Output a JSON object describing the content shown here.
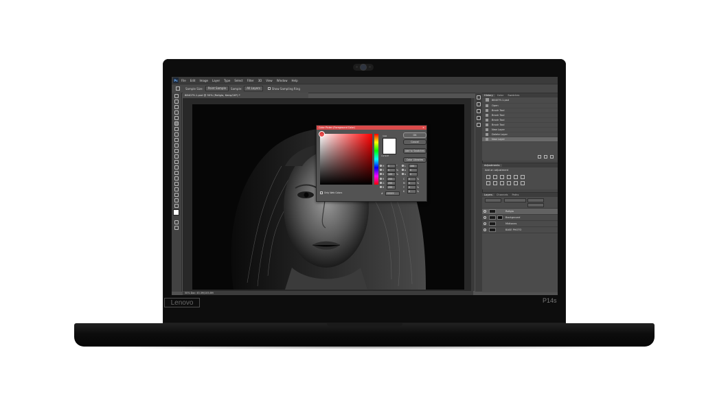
{
  "device": {
    "brand_left": "Lenovo",
    "model_right": "P14s"
  },
  "app": {
    "menu": [
      "File",
      "Edit",
      "Image",
      "Layer",
      "Type",
      "Select",
      "Filter",
      "3D",
      "View",
      "Window",
      "Help"
    ],
    "logo": "Ps",
    "options": {
      "sample_size_label": "Sample Size:",
      "sample_size_value": "Point Sample",
      "sample_label": "Sample:",
      "sample_value": "All Layers",
      "show_ring_label": "Show Sampling Ring"
    },
    "document_tab": "884079-1.psd @ 50% (Rollglo, Keep/16*) *",
    "status": "50%     Doc: 45.3M/105.8M"
  },
  "color_picker": {
    "title": "Color Picker (Foreground Color)",
    "ok": "OK",
    "cancel": "Cancel",
    "add_to_swatches": "Add to Swatches",
    "color_libraries": "Color Libraries",
    "new_label": "new",
    "current_label": "current",
    "only_web_colors": "Only Web Colors",
    "hex_label": "#",
    "hex_value": "FFFFFF",
    "fields": [
      {
        "label": "H",
        "value": "0",
        "unit": "°"
      },
      {
        "label": "S",
        "value": "0",
        "unit": "%"
      },
      {
        "label": "B",
        "value": "100",
        "unit": "%"
      },
      {
        "label": "R",
        "value": "255",
        "unit": ""
      },
      {
        "label": "G",
        "value": "255",
        "unit": ""
      },
      {
        "label": "B",
        "value": "255",
        "unit": ""
      }
    ],
    "lab_cmyk": [
      {
        "label": "L",
        "value": "100"
      },
      {
        "label": "a",
        "value": "0"
      },
      {
        "label": "b",
        "value": "0"
      },
      {
        "label": "C",
        "value": "0",
        "unit": "%"
      },
      {
        "label": "M",
        "value": "0",
        "unit": "%"
      },
      {
        "label": "Y",
        "value": "0",
        "unit": "%"
      },
      {
        "label": "K",
        "value": "0",
        "unit": "%"
      }
    ]
  },
  "history": {
    "tabs": [
      "History",
      "Color",
      "Swatches"
    ],
    "snapshot": "884079-1.psd",
    "items": [
      "Open",
      "Brush Tool",
      "Brush Tool",
      "Brush Tool",
      "Brush Tool",
      "New Layer",
      "Delete Layer",
      "New Layer"
    ]
  },
  "adjustments": {
    "title": "Adjustments",
    "subtitle": "Add an adjustment"
  },
  "layers": {
    "tabs": [
      "Layers",
      "Channels",
      "Paths"
    ],
    "rows": [
      "Rollglo",
      "Background",
      "Midtones",
      "BASE PHOTO"
    ]
  }
}
